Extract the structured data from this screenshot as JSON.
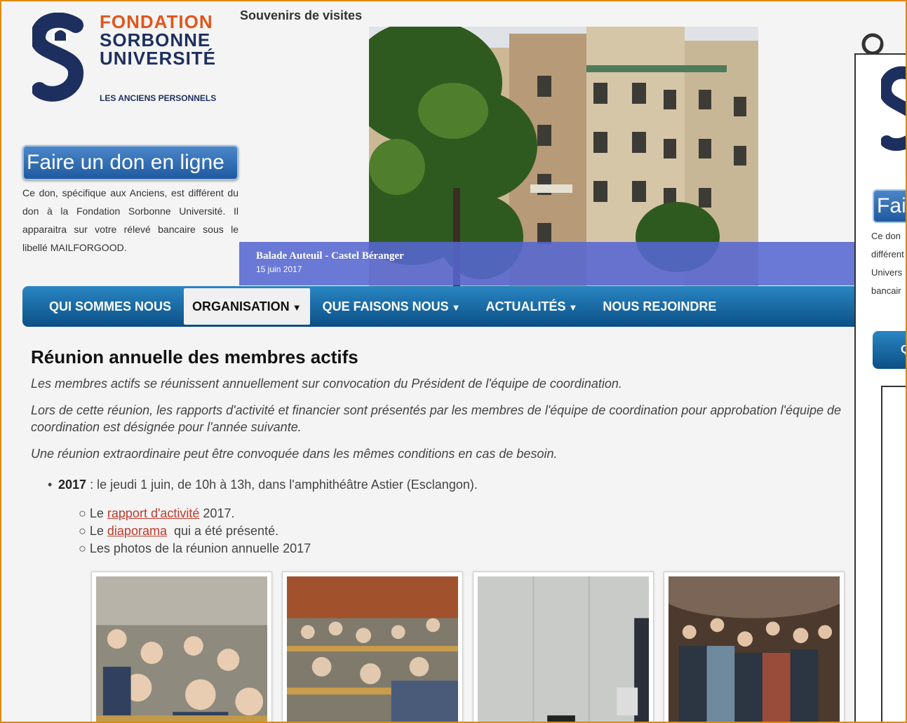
{
  "logo": {
    "line1": "FONDATION",
    "line2": "SORBONNE",
    "line3": "UNIVERSITÉ",
    "subtitle": "LES ANCIENS PERSONNELS",
    "colors": {
      "orange": "#e0561b",
      "navy": "#1d2f5e"
    }
  },
  "donation": {
    "button_label": "Faire un don en ligne",
    "text": "Ce don, spécifique aux Anciens, est différent du don à la Fondation Sorbonne Université. Il apparaitra sur votre rélevé bancaire sous le libellé MAILFORGOOD."
  },
  "slideshow": {
    "title": "Souvenirs de visites",
    "caption_title": "Balade Auteuil - Castel Béranger",
    "caption_date": "15 juin 2017"
  },
  "nav": {
    "items": [
      {
        "label": "QUI SOMMES NOUS",
        "dropdown": false,
        "active": false
      },
      {
        "label": "ORGANISATION",
        "dropdown": true,
        "active": true
      },
      {
        "label": "QUE FAISONS NOUS",
        "dropdown": true,
        "active": false
      },
      {
        "label": "ACTUALITÉS",
        "dropdown": true,
        "active": false
      },
      {
        "label": "NOUS REJOINDRE",
        "dropdown": false,
        "active": false
      }
    ],
    "caret": "▼"
  },
  "main": {
    "title": "Réunion annuelle des membres actifs",
    "para1": "Les membres actifs se réunissent annuellement sur convocation du Président de l'équipe de coordination.",
    "para2": "Lors de cette réunion, les rapports d'activité et financier sont présentés par les membres de l'équipe de coordination pour approbation l'équipe de coordination est désignée pour l'année suivante.",
    "para3": "Une réunion extraordinaire peut être convoquée dans les mêmes conditions en cas de besoin.",
    "year": "2017",
    "year_text": " : le jeudi 1 juin, de 10h à 13h, dans l'amphithéâtre Astier (Esclangon).",
    "items": [
      {
        "prefix": "Le ",
        "link": "rapport d'activité",
        "suffix": " 2017."
      },
      {
        "prefix": "Le ",
        "link": "diaporama",
        "suffix": "  qui a été présenté."
      },
      {
        "prefix": "Les photos de la réunion annuelle 2017",
        "link": "",
        "suffix": ""
      }
    ]
  },
  "overlay": {
    "button_label": "Fair",
    "text_lines": [
      "Ce  don",
      "différent",
      "Univers",
      "bancair"
    ],
    "nav_label": "Q"
  }
}
